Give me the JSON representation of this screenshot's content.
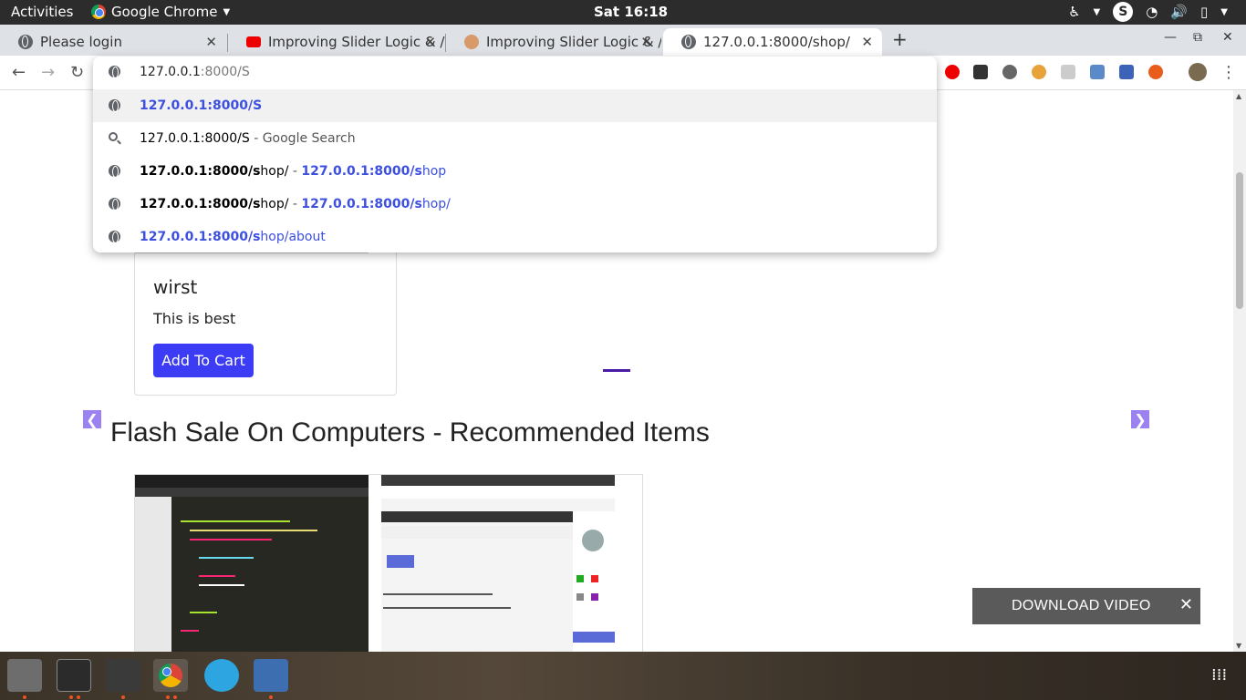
{
  "system": {
    "activities": "Activities",
    "app_menu": "Google Chrome",
    "clock": "Sat 16:18",
    "tray_icons": [
      "accessibility-icon",
      "skype-icon",
      "wifi-icon",
      "volume-icon",
      "battery-icon"
    ]
  },
  "tabs": [
    {
      "label": "Please login",
      "favicon": "globe-icon"
    },
    {
      "label": "Improving Slider Logic & /",
      "favicon": "youtube-icon"
    },
    {
      "label": "Improving Slider Logic & /",
      "favicon": "avatar-icon"
    },
    {
      "label": "127.0.0.1:8000/shop/",
      "favicon": "globe-icon"
    }
  ],
  "omnibox": {
    "typed": "127.0.0.1",
    "hint": ":8000/S",
    "suggestions": [
      {
        "bold": "127.0.0.1:8000/S",
        "rest": "",
        "sep": "",
        "url_bold": "",
        "url_rest": "",
        "style": "blue"
      },
      {
        "bold": "127.0.0.1:8000/S",
        "rest": " - Google Search",
        "sep": "",
        "url_bold": "",
        "url_rest": "",
        "style": "search"
      },
      {
        "bold": "127.0.0.1:8000/s",
        "rest": "hop/",
        "sep": " - ",
        "url_bold": "127.0.0.1:8000/s",
        "url_rest": "hop",
        "style": "mixed"
      },
      {
        "bold": "127.0.0.1:8000/s",
        "rest": "hop/",
        "sep": " - ",
        "url_bold": "127.0.0.1:8000/s",
        "url_rest": "hop/",
        "style": "mixed"
      },
      {
        "bold": "127.0.0.1:8000/s",
        "rest": "hop/about",
        "sep": "",
        "url_bold": "",
        "url_rest": "",
        "style": "blue"
      }
    ]
  },
  "product": {
    "title": "wirst",
    "description": "This is best",
    "button": "Add To Cart"
  },
  "section": {
    "title": "Flash Sale On Computers - Recommended Items"
  },
  "download_bar": {
    "label": "DOWNLOAD VIDEO",
    "close": "✕"
  },
  "colors": {
    "accent_button": "#3c3cf5",
    "slider_arrow": "#9c82f0",
    "suggestion_link": "#3c4fe0"
  }
}
